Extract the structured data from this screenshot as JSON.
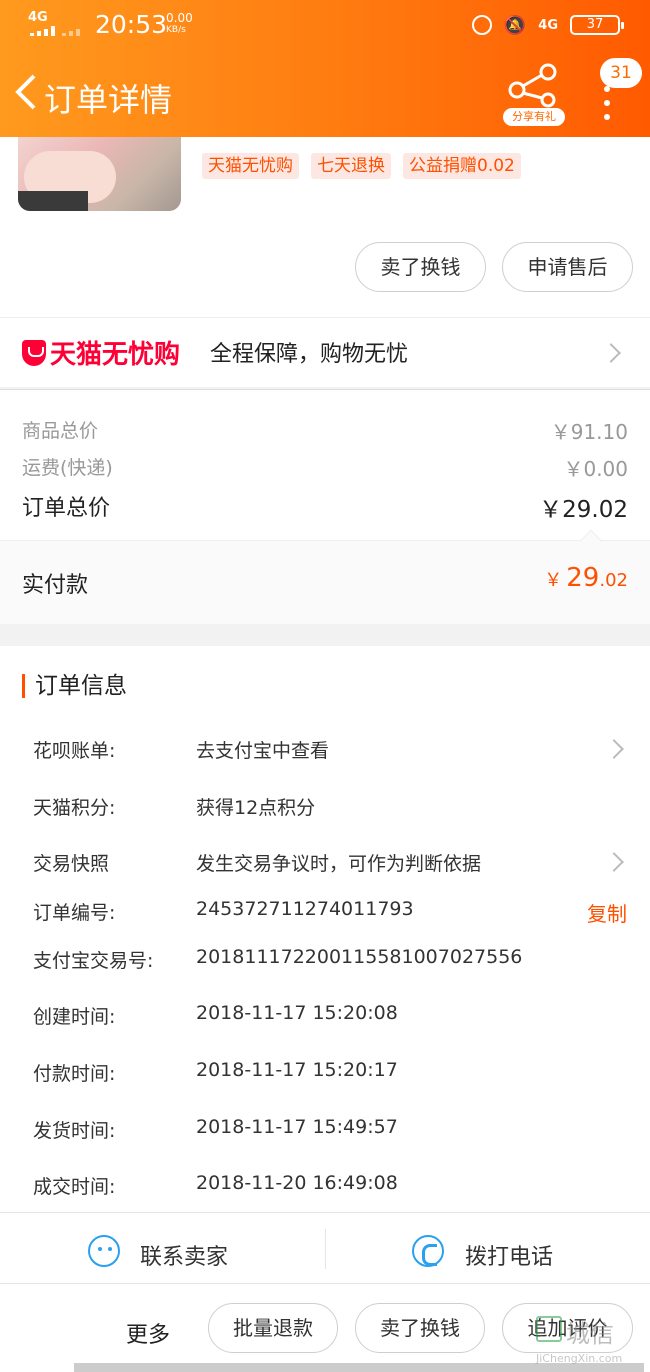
{
  "status_bar": {
    "signal1": "4G",
    "time": "20:53",
    "speed_value": "0.00",
    "speed_unit": "KB/s",
    "signal2": "4G",
    "battery": "37"
  },
  "nav": {
    "back_icon": "chevron-left-icon",
    "title": "订单详情",
    "share_label": "分享有礼",
    "badge_count": "31"
  },
  "product": {
    "tags": [
      "天猫无忧购",
      "七天退换",
      "公益捐赠0.02"
    ],
    "actions": [
      "卖了换钱",
      "申请售后"
    ]
  },
  "assurance": {
    "brand": "天猫无忧购",
    "slogan": "全程保障，购物无忧"
  },
  "pricing": {
    "goods_total_label": "商品总价",
    "goods_total_value": "￥91.10",
    "shipping_label": "运费(快递)",
    "shipping_value": "￥0.00",
    "order_total_label": "订单总价",
    "order_total_value": "￥29.02",
    "paid_label": "实付款",
    "paid_currency": "￥",
    "paid_int": "29",
    "paid_dec": ".02"
  },
  "order_info": {
    "heading": "订单信息",
    "rows": [
      {
        "label": "花呗账单:",
        "value": "去支付宝中查看"
      },
      {
        "label": "天猫积分:",
        "value": "获得12点积分"
      },
      {
        "label": "交易快照",
        "value": "发生交易争议时，可作为判断依据"
      },
      {
        "label": "订单编号:",
        "value": "245372711274011793"
      },
      {
        "label": "支付宝交易号:",
        "value": "2018111722001155810070275​56"
      },
      {
        "label": "创建时间:",
        "value": "2018-11-17 15:20:08"
      },
      {
        "label": "付款时间:",
        "value": "2018-11-17 15:20:17"
      },
      {
        "label": "发货时间:",
        "value": "2018-11-17 15:49:57"
      },
      {
        "label": "成交时间:",
        "value": "2018-11-20 16:49:08"
      }
    ],
    "copy_label": "复制"
  },
  "bottom_bar": {
    "contact_seller": "联系卖家",
    "call_phone": "拨打电话",
    "more": "更多",
    "buttons": [
      "批量退款",
      "卖了换钱",
      "追加评价"
    ]
  },
  "watermark": {
    "text": "城信",
    "url": "JiChengXin.com"
  },
  "colors": {
    "accent": "#ff5000",
    "header_start": "#ff9a1e",
    "header_end": "#ff5a00",
    "tmall_red": "#ff0036",
    "icon_blue": "#2aa0f0"
  }
}
